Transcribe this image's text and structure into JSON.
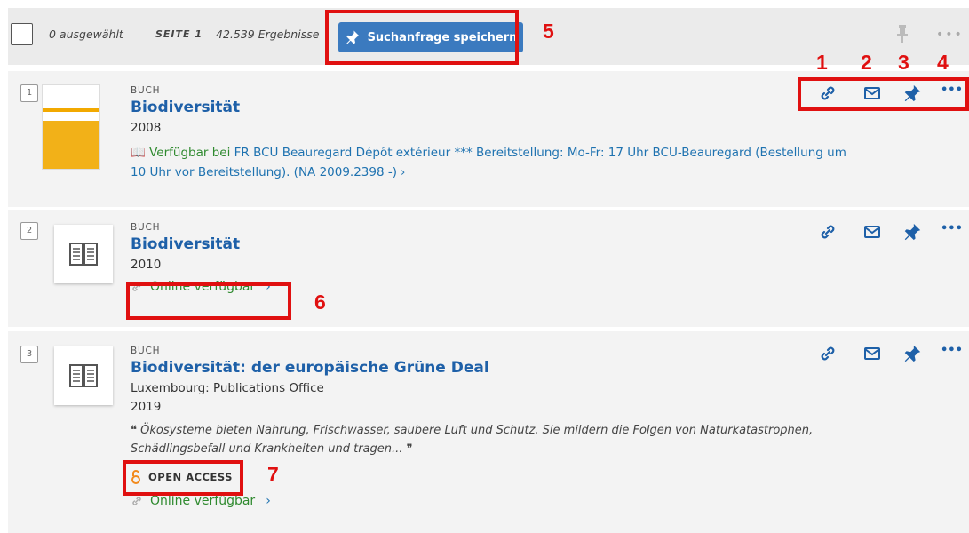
{
  "toolbar": {
    "selected": "0 ausgewählt",
    "page": "SEITE 1",
    "results": "42.539 Ergebnisse",
    "save_label": "Suchanfrage speichern"
  },
  "results": [
    {
      "number": "1",
      "type": "BUCH",
      "title": "Biodiversität",
      "year": "2008",
      "availability_prefix": "Verfügbar bei",
      "availability_location": "FR BCU Beauregard  Dépôt extérieur *** Bereitstellung: Mo-Fr: 17 Uhr BCU-Beauregard (Bestellung um",
      "availability_location_cont": "10 Uhr vor Bereitstellung). (NA 2009.2398 -)"
    },
    {
      "number": "2",
      "type": "BUCH",
      "title": "Biodiversität",
      "year": "2010",
      "online": "Online verfügbar"
    },
    {
      "number": "3",
      "type": "BUCH",
      "title": "Biodiversität: der europäische Grüne Deal",
      "publisher": "Luxembourg: Publications Office",
      "year": "2019",
      "quote": "Ökosysteme bieten Nahrung, Frischwasser, saubere Luft und Schutz. Sie mildern die Folgen von Naturkatastrophen, Schädlingsbefall und Krankheiten und tragen...",
      "open_access": "OPEN ACCESS",
      "online": "Online verfügbar"
    }
  ],
  "annotations": [
    "1",
    "2",
    "3",
    "4",
    "5",
    "6",
    "7"
  ],
  "colors": {
    "accent": "#3b7abf",
    "title": "#1e60a8",
    "available": "#2f8a2f",
    "annotation": "#e01010"
  }
}
